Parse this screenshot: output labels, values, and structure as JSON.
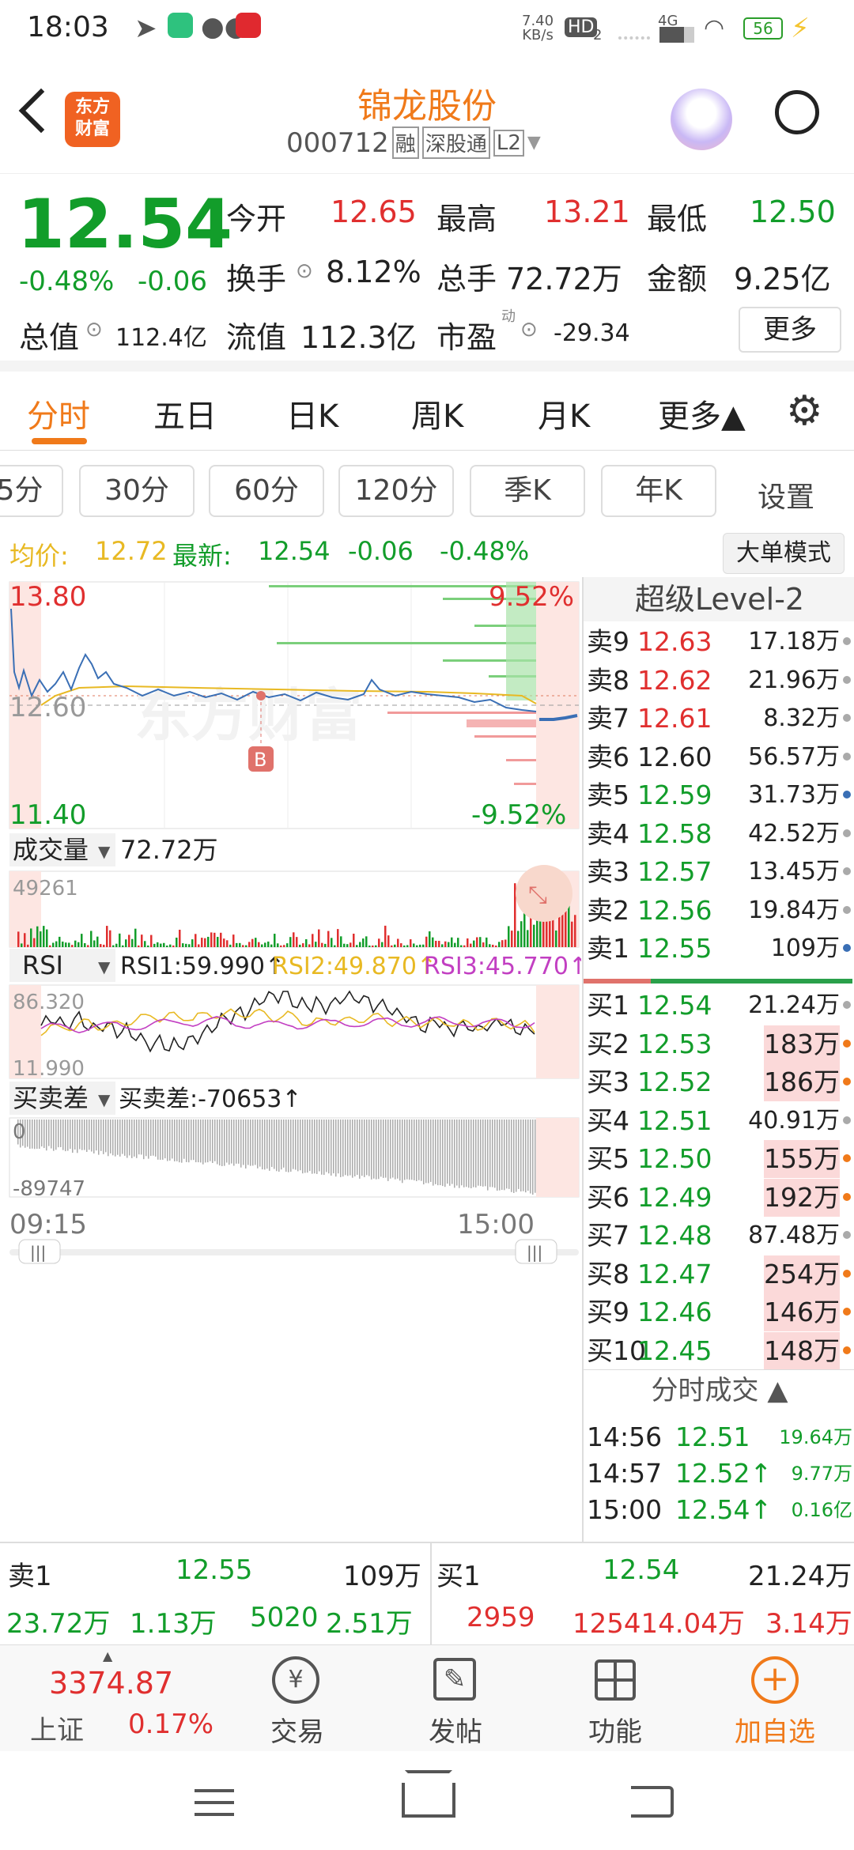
{
  "status": {
    "time": "18:03",
    "net_speed_top": "7.40",
    "net_speed_bottom": "KB/s",
    "hd": "HD",
    "hd_sub": "2",
    "cell": "4G",
    "battery": "56"
  },
  "header": {
    "brand_line1": "东方",
    "brand_line2": "财富",
    "stock_name": "锦龙股份",
    "stock_code": "000712",
    "tag_margin": "融",
    "tag_connect": "深股通",
    "tag_level": "L2"
  },
  "quote": {
    "price": "12.54",
    "change_pct": "-0.48%",
    "change": "-0.06",
    "open_label": "今开",
    "open": "12.65",
    "high_label": "最高",
    "high": "13.21",
    "low_label": "最低",
    "low": "12.50",
    "turnover_label": "换手",
    "turnover": "8.12%",
    "volume_label": "总手",
    "volume": "72.72万",
    "amount_label": "金额",
    "amount": "9.25亿",
    "mcap_label": "总值",
    "mcap": "112.4亿",
    "float_label": "流值",
    "float": "112.3亿",
    "pe_label": "市盈",
    "pe_sup": "动",
    "pe": "-29.34",
    "more": "更多"
  },
  "tabs": [
    {
      "label": "分时"
    },
    {
      "label": "五日"
    },
    {
      "label": "日K"
    },
    {
      "label": "周K"
    },
    {
      "label": "月K"
    },
    {
      "label": "更多▲"
    }
  ],
  "periods": [
    {
      "label": "5分"
    },
    {
      "label": "30分"
    },
    {
      "label": "60分"
    },
    {
      "label": "120分"
    },
    {
      "label": "季K"
    },
    {
      "label": "年K"
    }
  ],
  "periods_settings": "设置",
  "avg_row": {
    "avg_label": "均价:",
    "avg": "12.72",
    "latest_label": "最新:",
    "latest": "12.54",
    "chg": "-0.06",
    "pct": "-0.48%",
    "big_order": "大单模式"
  },
  "chart": {
    "price_high": "13.80",
    "price_mid": "12.60",
    "price_low": "11.40",
    "pct_high": "9.52%",
    "pct_low": "-9.52%",
    "watermark": "东方财富",
    "marker": "B",
    "vol_label": "成交量",
    "vol_value": "72.72万",
    "vol_max": "49261",
    "rsi_label": "RSI",
    "rsi1": "RSI1:59.990↑",
    "rsi2": "RSI2:49.870↑",
    "rsi3": "RSI3:45.770↑",
    "rsi_max": "86.320",
    "rsi_min": "11.990",
    "diff_label": "买卖差",
    "diff_value": "买卖差:-70653↑",
    "diff_max": "0",
    "diff_min": "-89747",
    "time_start": "09:15",
    "time_end": "15:00"
  },
  "level2": {
    "title": "超级Level-2",
    "asks": [
      {
        "label": "卖9",
        "price": "12.63",
        "vol": "17.18万"
      },
      {
        "label": "卖8",
        "price": "12.62",
        "vol": "21.96万"
      },
      {
        "label": "卖7",
        "price": "12.61",
        "vol": "8.32万"
      },
      {
        "label": "卖6",
        "price": "12.60",
        "vol": "56.57万"
      },
      {
        "label": "卖5",
        "price": "12.59",
        "vol": "31.73万"
      },
      {
        "label": "卖4",
        "price": "12.58",
        "vol": "42.52万"
      },
      {
        "label": "卖3",
        "price": "12.57",
        "vol": "13.45万"
      },
      {
        "label": "卖2",
        "price": "12.56",
        "vol": "19.84万"
      },
      {
        "label": "卖1",
        "price": "12.55",
        "vol": "109万"
      }
    ],
    "bids": [
      {
        "label": "买1",
        "price": "12.54",
        "vol": "21.24万"
      },
      {
        "label": "买2",
        "price": "12.53",
        "vol": "183万"
      },
      {
        "label": "买3",
        "price": "12.52",
        "vol": "186万"
      },
      {
        "label": "买4",
        "price": "12.51",
        "vol": "40.91万"
      },
      {
        "label": "买5",
        "price": "12.50",
        "vol": "155万"
      },
      {
        "label": "买6",
        "price": "12.49",
        "vol": "192万"
      },
      {
        "label": "买7",
        "price": "12.48",
        "vol": "87.48万"
      },
      {
        "label": "买8",
        "price": "12.47",
        "vol": "254万"
      },
      {
        "label": "买9",
        "price": "12.46",
        "vol": "146万"
      },
      {
        "label": "买10",
        "price": "12.45",
        "vol": "148万"
      }
    ],
    "ticks_title": "分时成交 ▲",
    "ticks": [
      {
        "time": "14:56",
        "price": "12.51",
        "vol": "19.64万"
      },
      {
        "time": "14:57",
        "price": "12.52↑",
        "vol": "9.77万"
      },
      {
        "time": "15:00",
        "price": "12.54↑",
        "vol": "0.16亿"
      }
    ]
  },
  "summary": {
    "sell_label": "卖1",
    "sell_price": "12.55",
    "sell_vol": "109万",
    "buy_label": "买1",
    "buy_price": "12.54",
    "buy_vol": "21.24万",
    "r2": [
      "23.72万",
      "1.13万",
      "5020",
      "2.51万",
      "2959",
      "125414.04万",
      "3.14万"
    ]
  },
  "bottom_nav": {
    "index_value": "3374.87",
    "index_name": "上证",
    "index_pct": "0.17%",
    "trade": "交易",
    "post": "发帖",
    "func": "功能",
    "watch": "加自选"
  }
}
